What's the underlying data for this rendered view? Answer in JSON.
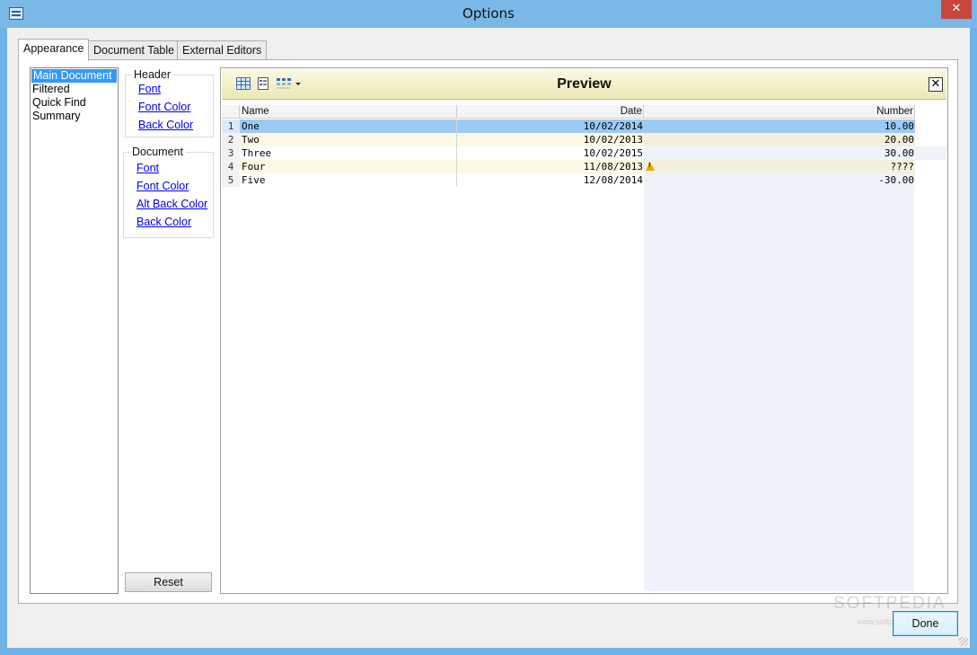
{
  "window": {
    "title": "Options",
    "close_label": "✕"
  },
  "tabs": [
    {
      "label": "Appearance",
      "active": true
    },
    {
      "label": "Document Table",
      "active": false
    },
    {
      "label": "External Editors",
      "active": false
    }
  ],
  "categories": [
    {
      "label": "Main Document",
      "selected": true
    },
    {
      "label": "Filtered",
      "selected": false
    },
    {
      "label": "Quick Find",
      "selected": false
    },
    {
      "label": "Summary",
      "selected": false
    }
  ],
  "header_group": {
    "title": "Header",
    "links": [
      "Font",
      "Font Color",
      "Back Color"
    ]
  },
  "document_group": {
    "title": "Document",
    "links": [
      "Font",
      "Font Color",
      "Alt Back Color",
      "Back Color"
    ]
  },
  "reset_label": "Reset",
  "preview": {
    "title": "Preview",
    "close_label": "✕",
    "toolbar_icons": [
      "table-icon",
      "record-icon",
      "columns-dropdown-icon"
    ],
    "columns": [
      "Name",
      "Date",
      "Number"
    ],
    "rows": [
      {
        "index": "1",
        "name": "One",
        "date": "10/02/2014",
        "number": "10.00",
        "selected": true,
        "warning": false
      },
      {
        "index": "2",
        "name": "Two",
        "date": "10/02/2013",
        "number": "20.00",
        "selected": false,
        "warning": false
      },
      {
        "index": "3",
        "name": "Three",
        "date": "10/02/2015",
        "number": "30.00",
        "selected": false,
        "warning": false
      },
      {
        "index": "4",
        "name": "Four",
        "date": "11/08/2013",
        "number": "????",
        "selected": false,
        "warning": true
      },
      {
        "index": "5",
        "name": "Five",
        "date": "12/08/2014",
        "number": "-30.00",
        "selected": false,
        "warning": false
      }
    ]
  },
  "done_label": "Done",
  "watermark": {
    "main": "SOFTPEDIA",
    "sub": "www.softpedia.com"
  },
  "colors": {
    "title_bar": "#7ab8e8",
    "selection": "#3399ff",
    "row_selected": "#9ccaf5",
    "link": "#0000ee",
    "preview_header": "#f5f2c9"
  }
}
